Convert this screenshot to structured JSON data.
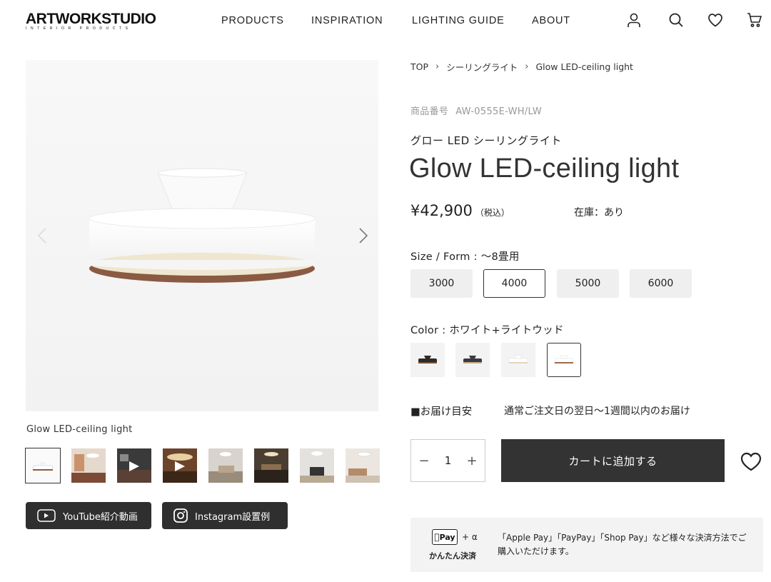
{
  "header": {
    "logo_main": "ARTWORKSTUDIO",
    "logo_sub": "INTERIOR PRODUCTS",
    "nav": [
      "PRODUCTS",
      "INSPIRATION",
      "LIGHTING GUIDE",
      "ABOUT"
    ],
    "icons": [
      "user-icon",
      "search-icon",
      "heart-icon",
      "cart-icon"
    ]
  },
  "gallery": {
    "caption": "Glow LED-ceiling light",
    "thumb_count": 8,
    "buttons": {
      "youtube": "YouTube紹介動画",
      "instagram": "Instagram設置例"
    }
  },
  "breadcrumb": [
    "TOP",
    "シーリングライト",
    "Glow LED-ceiling light"
  ],
  "product": {
    "sku_label": "商品番号",
    "sku": "AW-0555E-WH/LW",
    "name_jp": "グロー LED シーリングライト",
    "name": "Glow LED-ceiling light",
    "price": "¥42,900",
    "tax_note": "（税込）",
    "stock": "在庫：あり"
  },
  "options": {
    "size_label": "Size / Form :",
    "size_value": "〜8畳用",
    "sizes": [
      "3000",
      "4000",
      "5000",
      "6000"
    ],
    "selected_size": "4000",
    "color_label": "Color :",
    "color_value": "ホワイト+ライトウッド",
    "colors": [
      "#2b2b2b",
      "#3a3a42",
      "#ffffff",
      "#ffffff"
    ],
    "selected_color_index": 3
  },
  "delivery": {
    "label": "■お届け目安",
    "text": "通常ご注文日の翌日〜1週間以内のお届け"
  },
  "purchase": {
    "qty_minus": "−",
    "qty_value": "1",
    "qty_plus": "+",
    "cart_label": "カートに追加する"
  },
  "payment": {
    "badge": "Pay",
    "plus": "+ α",
    "caption": "かんたん決済",
    "text": "「Apple Pay」「PayPay」「Shop Pay」など様々な決済方法でご購入いただけます。"
  }
}
